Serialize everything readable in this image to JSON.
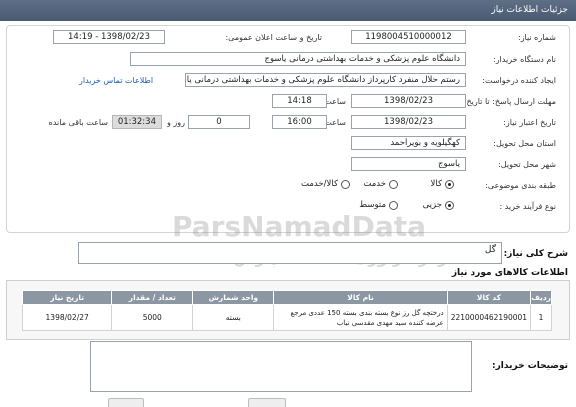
{
  "header": {
    "title": "جزئیات اطلاعات نیاز"
  },
  "form": {
    "need_number_label": "شماره نیاز:",
    "need_number": "1198004510000012",
    "announce_label": "تاریخ و ساعت اعلان عمومی:",
    "announce_value": "1398/02/23 - 14:19",
    "buyer_label": "نام دستگاه خریدار:",
    "buyer_value": "دانشگاه علوم پزشکی و خدمات بهداشتی درمانی یاسوج",
    "creator_label": "ایجاد کننده درخواست:",
    "creator_value": "رستم حلال منفرد کارپرداز دانشگاه علوم پزشکی و خدمات بهداشتی درمانی یاسوج",
    "contact_link": "اطلاعات تماس خریدار",
    "reply_deadline_label": "مهلت ارسال پاسخ: تا تاریخ:",
    "reply_date": "1398/02/23",
    "time_label": "ساعت",
    "reply_time": "14:18",
    "validity_label": "تاریخ اعتبار نیاز:",
    "validity_date": "1398/02/23",
    "validity_time": "16:00",
    "days_value": "0",
    "days_label": "روز و",
    "remaining_value": "01:32:34",
    "remaining_label": "ساعت باقی مانده",
    "province_label": "استان محل تحویل:",
    "province_value": "کهگیلویه و بویراحمد",
    "city_label": "شهر محل تحویل:",
    "city_value": "یاسوج",
    "category_label": "طبقه بندی موضوعی:",
    "category_options": [
      "کالا",
      "خدمت",
      "کالا/خدمت"
    ],
    "category_selected": "کالا",
    "process_label": "نوع فرآیند خرید :",
    "process_options": [
      "جزیی",
      "متوسط"
    ],
    "process_selected": "جزیی"
  },
  "watermark": {
    "line1": "ParsNamadData",
    "line2": "مرکز فرآوری اطلاعات پارس نماد داده",
    "line3": "پایگاه اطلاع رسانی مناقصه و مزایده"
  },
  "summary": {
    "label": "شرح کلی نیاز:",
    "value": "گل"
  },
  "goods": {
    "title": "اطلاعات کالاهای مورد نیاز",
    "headers": [
      "ردیف",
      "کد کالا",
      "نام کالا",
      "واحد شمارش",
      "تعداد / مقدار",
      "تاریخ نیاز"
    ],
    "rows": [
      [
        "1",
        "2210000462190001",
        "درختچه گل رز نوع بسته بندی بسته 150 عددی مرجع عرضه کننده سید مهدی مقدسی نیاب",
        "بسته",
        "5000",
        "1398/02/27"
      ]
    ]
  },
  "description": {
    "label": "توضیحات خریدار:",
    "value": ""
  }
}
